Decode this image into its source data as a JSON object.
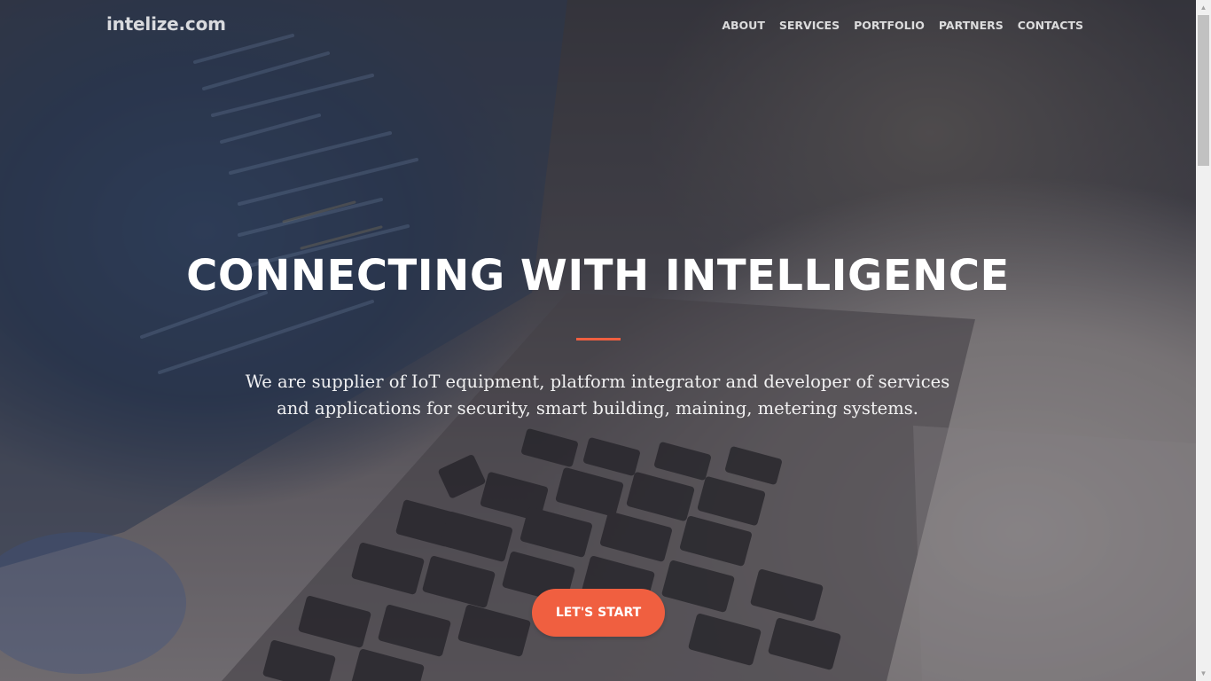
{
  "navbar": {
    "brand": "intelize.com",
    "links": [
      {
        "label": "ABOUT"
      },
      {
        "label": "SERVICES"
      },
      {
        "label": "PORTFOLIO"
      },
      {
        "label": "PARTNERS"
      },
      {
        "label": "CONTACTS"
      }
    ]
  },
  "hero": {
    "headline": "CONNECTING WITH INTELLIGENCE",
    "tagline_line1": "We are supplier of IoT equipment, platform integrator and developer of services",
    "tagline_line2": "and applications for security, smart building, maining, metering systems.",
    "cta_label": "LET'S START"
  },
  "colors": {
    "accent": "#f05f40",
    "text": "#ffffff",
    "overlay": "#28283088"
  },
  "scrollbar": {
    "up_icon": "chevron-up-icon",
    "down_icon": "chevron-down-icon"
  }
}
